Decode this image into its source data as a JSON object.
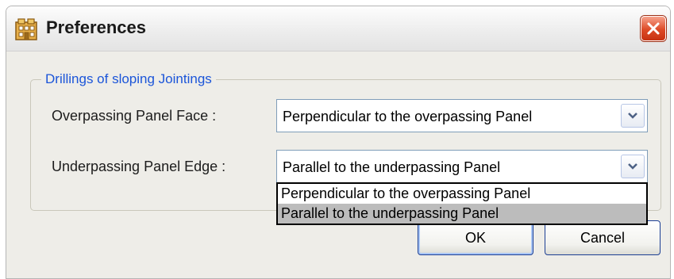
{
  "window": {
    "title": "Preferences"
  },
  "group": {
    "legend": "Drillings of sloping Jointings"
  },
  "fields": {
    "overpassing_label": "Overpassing Panel Face :",
    "overpassing_value": "Perpendicular to the overpassing Panel",
    "underpassing_label": "Underpassing Panel Edge :",
    "underpassing_value": "Parallel to the underpassing Panel"
  },
  "dropdown": {
    "options": [
      "Perpendicular to the overpassing Panel",
      "Parallel to the underpassing Panel"
    ],
    "highlighted_index": 1
  },
  "buttons": {
    "ok": "OK",
    "cancel": "Cancel"
  },
  "colors": {
    "legend": "#1b55d9",
    "close_button": "#dd4a26",
    "highlight": "#bcbcbc"
  },
  "icons": {
    "app": "preferences-building-icon",
    "close": "close-icon",
    "dropdown": "chevron-down-icon"
  }
}
